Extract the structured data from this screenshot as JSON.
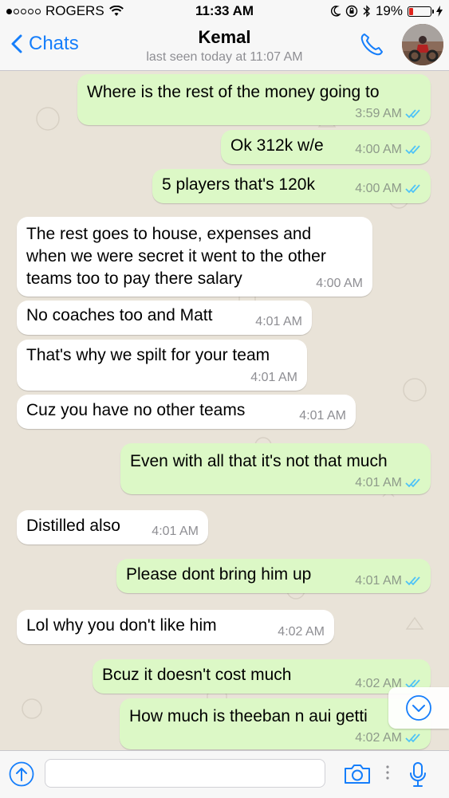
{
  "status_bar": {
    "carrier": "ROGERS",
    "time": "11:33 AM",
    "battery_percent": "19%",
    "battery_level": 0.19,
    "signal_bars_filled": 1,
    "signal_bars_total": 5
  },
  "nav": {
    "back_label": "Chats",
    "contact_name": "Kemal",
    "last_seen": "last seen today at 11:07 AM",
    "accent_color": "#157efb"
  },
  "messages": [
    {
      "dir": "out",
      "text": "Where is the rest of the money going to",
      "time": "3:59 AM",
      "read": true
    },
    {
      "dir": "out",
      "text": "Ok 312k w/e",
      "time": "4:00 AM",
      "read": true
    },
    {
      "dir": "out",
      "text": "5 players that's 120k",
      "time": "4:00 AM",
      "read": true
    },
    {
      "dir": "in",
      "lines": [
        "The rest goes to house, expenses and",
        "when we were secret it went to the other",
        "teams too to pay there salary"
      ],
      "time": "4:00 AM"
    },
    {
      "dir": "in",
      "text": "No coaches too and Matt",
      "time": "4:01 AM"
    },
    {
      "dir": "in",
      "text": "That's why we spilt for your team",
      "time": "4:01 AM"
    },
    {
      "dir": "in",
      "text": "Cuz you have no other teams",
      "time": "4:01 AM"
    },
    {
      "dir": "out",
      "text": "Even with all that it's not that much",
      "time": "4:01 AM",
      "read": true
    },
    {
      "dir": "in",
      "text": "Distilled also",
      "time": "4:01 AM"
    },
    {
      "dir": "out",
      "text": "Please dont bring him up",
      "time": "4:01 AM",
      "read": true
    },
    {
      "dir": "in",
      "text": "Lol why you don't like him",
      "time": "4:02 AM"
    },
    {
      "dir": "out",
      "text": "Bcuz it doesn't cost much",
      "time": "4:02 AM",
      "read": true
    },
    {
      "dir": "out",
      "text": "How much is theeban n aui getti",
      "time": "4:02 AM",
      "read": true
    }
  ],
  "input": {
    "placeholder": "",
    "value": ""
  },
  "colors": {
    "outgoing_bubble": "#dcf8c6",
    "incoming_bubble": "#ffffff",
    "read_ticks": "#4fc3f7",
    "background": "#e9e3d8"
  },
  "icons": {
    "attach": "arrow-up-circle-icon",
    "camera": "camera-icon",
    "mic": "microphone-icon",
    "call": "phone-icon",
    "scroll": "chevron-down-circle-icon"
  }
}
